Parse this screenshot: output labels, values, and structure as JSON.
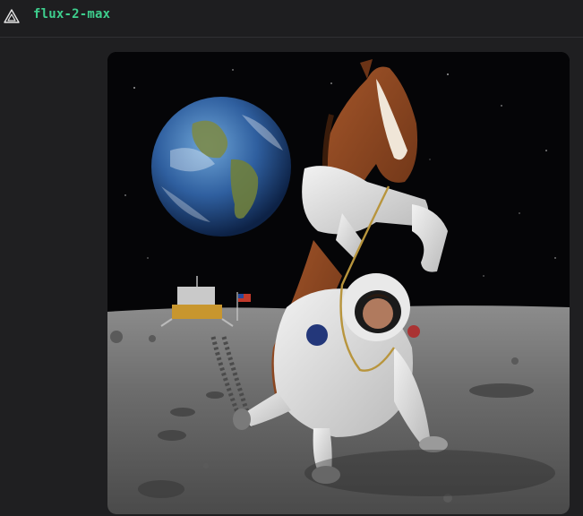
{
  "header": {
    "model_name": "flux-2-max",
    "logo_icon": "triangle-logo-icon"
  },
  "result_image": {
    "subject": "astronaut-on-all-fours-carrying-horse-on-moon-with-earth"
  },
  "colors": {
    "accent": "#3ecf8e",
    "background": "#1f1f21",
    "header_border": "#303033"
  }
}
